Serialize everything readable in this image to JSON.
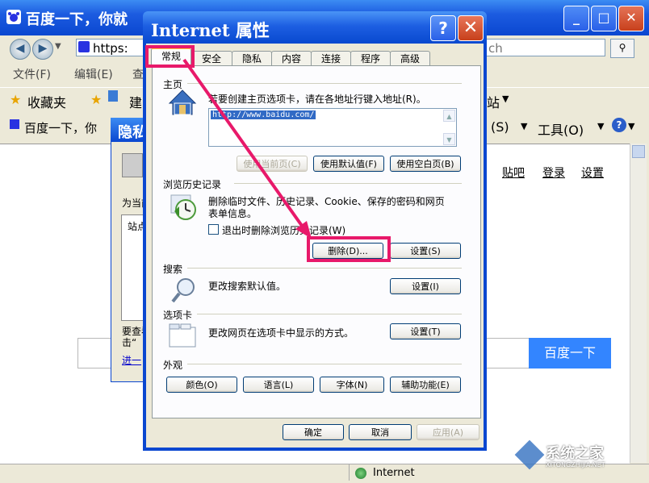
{
  "browser": {
    "title": "百度一下，你就",
    "address_left": "https:",
    "address_right": "ch",
    "menu": [
      "文件(F)",
      "编辑(E)",
      "查"
    ],
    "favorites_label": "收藏夹",
    "favorites_extra": "建",
    "tab_label": "百度一下，你",
    "tools": [
      "站",
      "(S)",
      "工具(O)"
    ],
    "page_links": [
      "贴吧",
      "登录",
      "设置"
    ],
    "search_button": "百度一下",
    "status_zone": "Internet"
  },
  "behind_dialog": {
    "title": "隐私",
    "text_lines": [
      "为当前",
      "站点",
      "要查看",
      "击“",
      "进一"
    ]
  },
  "dialog": {
    "title": "Internet 属性",
    "help_glyph": "?",
    "close_glyph": "✕",
    "tabs": [
      "常规",
      "安全",
      "隐私",
      "内容",
      "连接",
      "程序",
      "高级"
    ],
    "home": {
      "section": "主页",
      "description": "若要创建主页选项卡，请在各地址行键入地址(R)。",
      "url": "http://www.baidu.com/",
      "btn_current": "使用当前页(C)",
      "btn_default": "使用默认值(F)",
      "btn_blank": "使用空白页(B)"
    },
    "history": {
      "section": "浏览历史记录",
      "description_1": "删除临时文件、历史记录、Cookie、保存的密码和网页",
      "description_2": "表单信息。",
      "checkbox_label": "退出时删除浏览历史记录(W)",
      "btn_delete": "删除(D)...",
      "btn_settings": "设置(S)"
    },
    "search": {
      "section": "搜索",
      "description": "更改搜索默认值。",
      "btn_settings": "设置(I)"
    },
    "tabs_section": {
      "section": "选项卡",
      "description": "更改网页在选项卡中显示的方式。",
      "btn_settings": "设置(T)"
    },
    "appearance": {
      "section": "外观",
      "btn_colors": "颜色(O)",
      "btn_languages": "语言(L)",
      "btn_fonts": "字体(N)",
      "btn_accessibility": "辅助功能(E)"
    },
    "footer": {
      "ok": "确定",
      "cancel": "取消",
      "apply": "应用(A)"
    }
  },
  "watermark": {
    "name": "系统之家",
    "url": "XITONGZHIJIA.NET"
  },
  "colors": {
    "xp_blue": "#0a47d0",
    "highlight": "#e8196a",
    "baidu_blue": "#3385ff"
  }
}
